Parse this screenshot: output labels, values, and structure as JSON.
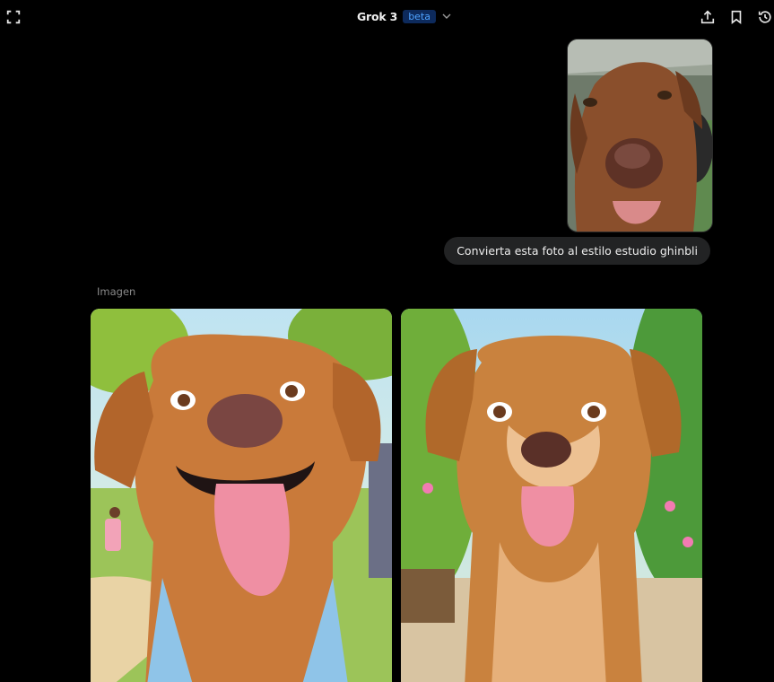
{
  "header": {
    "model_name": "Grok 3",
    "badge": "beta",
    "left_icon": "fullscreen-icon",
    "right_icons": [
      "share-icon",
      "bookmark-icon",
      "history-icon"
    ]
  },
  "conversation": {
    "user_message": "Convierta esta foto al estilo estudio ghinbli",
    "user_attachment": "dog-photo",
    "response_label": "Imagen",
    "generated_images": [
      "ghibli-dog-image-1",
      "ghibli-dog-image-2"
    ]
  },
  "colors": {
    "background": "#000000",
    "bubble": "#222324",
    "beta_badge_bg": "#0d2a5c",
    "beta_badge_text": "#4fa3ff"
  }
}
